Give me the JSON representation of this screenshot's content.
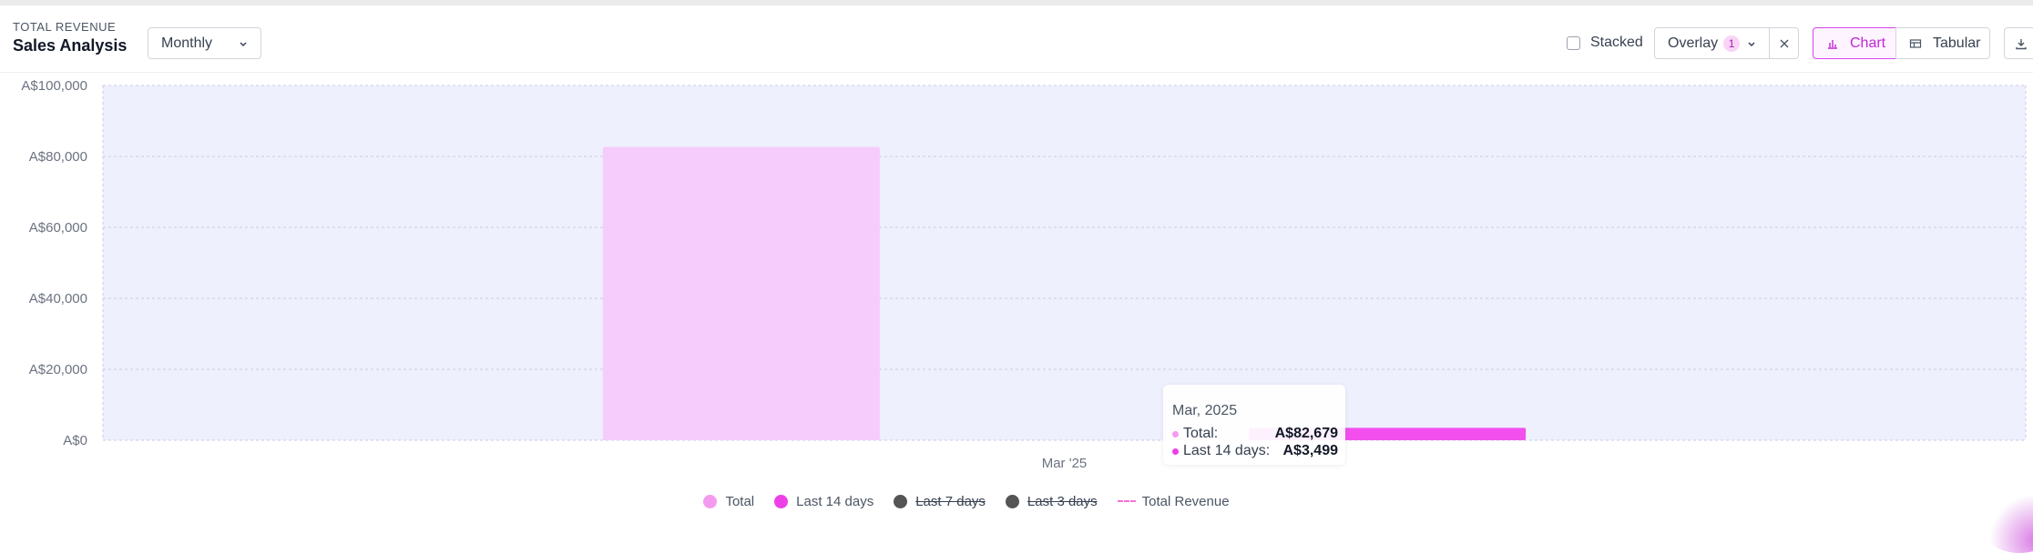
{
  "header": {
    "kicker": "TOTAL REVENUE",
    "title": "Sales Analysis",
    "period": "Monthly"
  },
  "controls": {
    "stacked_label": "Stacked",
    "overlay_label": "Overlay",
    "overlay_count": "1",
    "tab_chart": "Chart",
    "tab_tabular": "Tabular",
    "active_tab": "Chart"
  },
  "tooltip": {
    "title": "Mar, 2025",
    "rows": [
      {
        "name": "Total:",
        "value": "A$82,679",
        "color": "#f49bf0"
      },
      {
        "name": "Last 14 days:",
        "value": "A$3,499",
        "color": "#ee3fe6"
      }
    ]
  },
  "legend": [
    {
      "label": "Total",
      "color": "#f49bf0",
      "active": true
    },
    {
      "label": "Last 14 days",
      "color": "#ee3fe6",
      "active": true
    },
    {
      "label": "Last 7 days",
      "color": "#555555",
      "active": false
    },
    {
      "label": "Last 3 days",
      "color": "#555555",
      "active": false
    },
    {
      "label": "Total Revenue",
      "color": "#f472d6",
      "active": true,
      "style": "dashed-line"
    }
  ],
  "chart_data": {
    "type": "bar",
    "categories": [
      "Mar '25"
    ],
    "series": [
      {
        "name": "Total",
        "values": [
          82679
        ],
        "color": "#f5ccfc"
      },
      {
        "name": "Last 14 days",
        "values": [
          3499
        ],
        "color": "#f24fee"
      }
    ],
    "ylim": [
      0,
      100000
    ],
    "yticks": [
      0,
      20000,
      40000,
      60000,
      80000,
      100000
    ],
    "ytick_labels": [
      "A$0",
      "A$20,000",
      "A$40,000",
      "A$60,000",
      "A$80,000",
      "A$100,000"
    ],
    "plot_background": "#eef0fd",
    "grid": true,
    "legend_position": "bottom"
  }
}
